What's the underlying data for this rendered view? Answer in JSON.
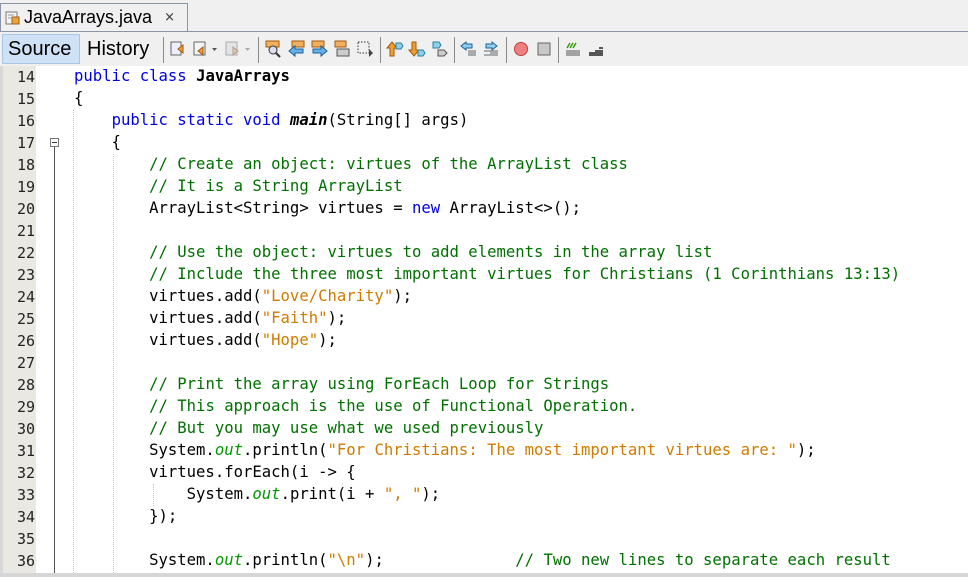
{
  "tab": {
    "title": "JavaArrays.java",
    "close_glyph": "×",
    "icon": "java-file-icon"
  },
  "toolbar": {
    "source_label": "Source",
    "history_label": "History",
    "icons": [
      "last-edit-icon",
      "back-icon",
      "forward-icon",
      "find-icon",
      "find-previous-icon",
      "find-next-icon",
      "toggle-highlight-icon",
      "toggle-rect-select-icon",
      "previous-bookmark-icon",
      "next-bookmark-icon",
      "toggle-bookmark-icon",
      "shift-left-icon",
      "shift-right-icon",
      "start-macro-icon",
      "stop-macro-icon",
      "comment-icon",
      "uncomment-icon"
    ]
  },
  "editor": {
    "lines": [
      {
        "n": "14",
        "tokens": [
          [
            "kw",
            "public class "
          ],
          [
            "cls",
            "JavaArrays"
          ]
        ]
      },
      {
        "n": "15",
        "tokens": [
          [
            "",
            "{"
          ]
        ]
      },
      {
        "n": "16",
        "tokens": [
          [
            "",
            "    "
          ],
          [
            "kw",
            "public static void "
          ],
          [
            "mth",
            "main"
          ],
          [
            "",
            "(String[] args)"
          ]
        ]
      },
      {
        "n": "17",
        "tokens": [
          [
            "",
            "    {"
          ]
        ]
      },
      {
        "n": "18",
        "tokens": [
          [
            "",
            "        "
          ],
          [
            "cm",
            "// Create an object: virtues of the ArrayList class"
          ]
        ]
      },
      {
        "n": "19",
        "tokens": [
          [
            "",
            "        "
          ],
          [
            "cm",
            "// It is a String ArrayList"
          ]
        ]
      },
      {
        "n": "20",
        "tokens": [
          [
            "",
            "        ArrayList<String> virtues = "
          ],
          [
            "kw",
            "new"
          ],
          [
            "",
            " ArrayList<>();"
          ]
        ]
      },
      {
        "n": "21",
        "tokens": []
      },
      {
        "n": "22",
        "tokens": [
          [
            "",
            "        "
          ],
          [
            "cm",
            "// Use the object: virtues to add elements in the array list"
          ]
        ]
      },
      {
        "n": "23",
        "tokens": [
          [
            "",
            "        "
          ],
          [
            "cm",
            "// Include the three most important virtues for Christians (1 Corinthians 13:13)"
          ]
        ]
      },
      {
        "n": "24",
        "tokens": [
          [
            "",
            "        virtues.add("
          ],
          [
            "st",
            "\"Love/Charity\""
          ],
          [
            "",
            ");"
          ]
        ]
      },
      {
        "n": "25",
        "tokens": [
          [
            "",
            "        virtues.add("
          ],
          [
            "st",
            "\"Faith\""
          ],
          [
            "",
            ");"
          ]
        ]
      },
      {
        "n": "26",
        "tokens": [
          [
            "",
            "        virtues.add("
          ],
          [
            "st",
            "\"Hope\""
          ],
          [
            "",
            ");"
          ]
        ]
      },
      {
        "n": "27",
        "tokens": []
      },
      {
        "n": "28",
        "tokens": [
          [
            "",
            "        "
          ],
          [
            "cm",
            "// Print the array using ForEach Loop for Strings"
          ]
        ]
      },
      {
        "n": "29",
        "tokens": [
          [
            "",
            "        "
          ],
          [
            "cm",
            "// This approach is the use of Functional Operation."
          ]
        ]
      },
      {
        "n": "30",
        "tokens": [
          [
            "",
            "        "
          ],
          [
            "cm",
            "// But you may use what we used previously"
          ]
        ]
      },
      {
        "n": "31",
        "tokens": [
          [
            "",
            "        System."
          ],
          [
            "fld",
            "out"
          ],
          [
            "",
            ".println("
          ],
          [
            "st",
            "\"For Christians: The most important virtues are: \""
          ],
          [
            "",
            ");"
          ]
        ]
      },
      {
        "n": "32",
        "tokens": [
          [
            "",
            "        virtues.forEach(i -> {"
          ]
        ]
      },
      {
        "n": "33",
        "tokens": [
          [
            "",
            "            System."
          ],
          [
            "fld",
            "out"
          ],
          [
            "",
            ".print(i + "
          ],
          [
            "st",
            "\", \""
          ],
          [
            "",
            ");"
          ]
        ]
      },
      {
        "n": "34",
        "tokens": [
          [
            "",
            "        });"
          ]
        ]
      },
      {
        "n": "35",
        "tokens": []
      },
      {
        "n": "36",
        "tokens": [
          [
            "",
            "        System."
          ],
          [
            "fld",
            "out"
          ],
          [
            "",
            ".println("
          ],
          [
            "st",
            "\"\\n\""
          ],
          [
            "",
            ");              "
          ],
          [
            "cm",
            "// Two new lines to separate each result"
          ]
        ]
      }
    ]
  }
}
